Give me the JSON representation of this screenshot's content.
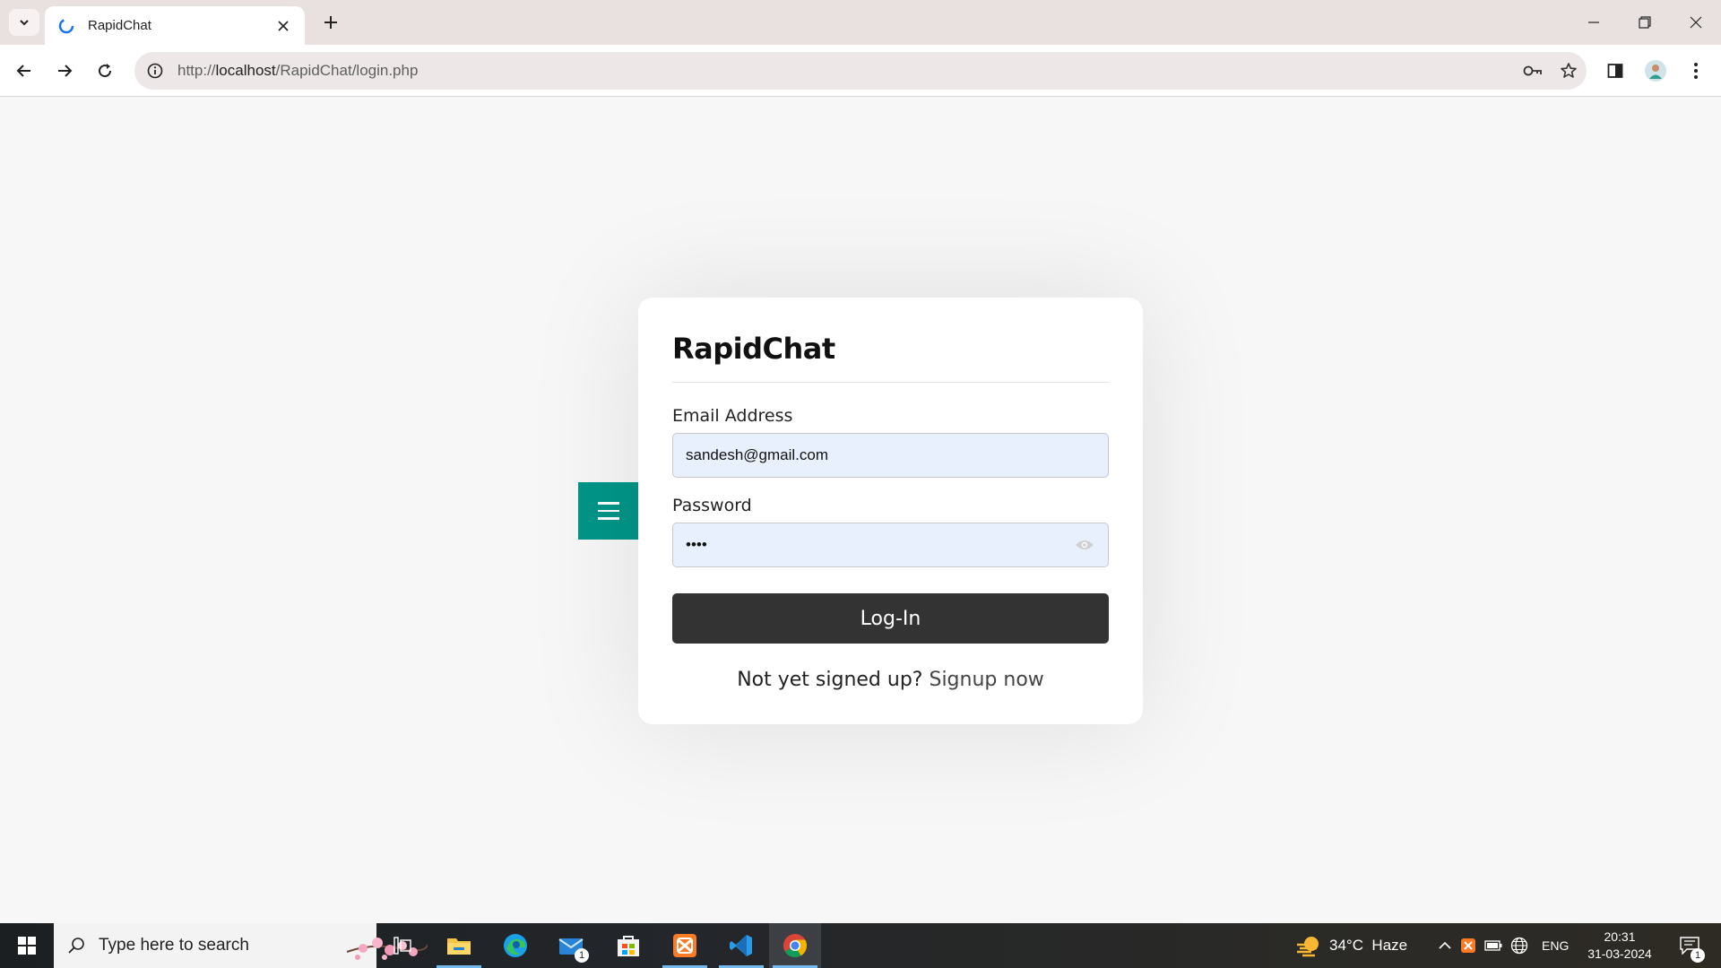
{
  "browser": {
    "tab_title": "RapidChat",
    "url_prefix": "http://",
    "url_host": "localhost",
    "url_path": "/RapidChat/login.php"
  },
  "login": {
    "brand": "RapidChat",
    "email_label": "Email Address",
    "email_value": "sandesh@gmail.com",
    "password_label": "Password",
    "password_value": "••••",
    "login_button": "Log-In",
    "signup_prompt": "Not yet signed up?",
    "signup_link": "Signup now"
  },
  "colors": {
    "accent": "#009688",
    "button": "#333333",
    "input_bg": "#e8f0fe"
  },
  "taskbar": {
    "search_placeholder": "Type here to search",
    "mail_badge": "1",
    "weather": "34°C  Haze",
    "language": "ENG",
    "time": "20:31",
    "date": "31-03-2024",
    "notification_badge": "1"
  }
}
